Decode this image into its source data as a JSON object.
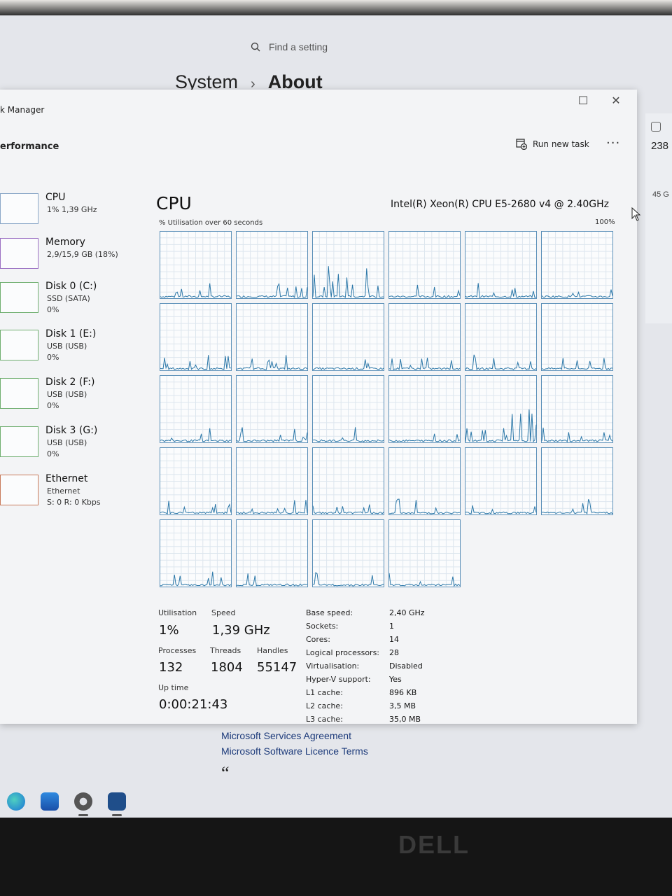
{
  "settings": {
    "search_placeholder": "Find a setting",
    "breadcrumb_parent": "System",
    "breadcrumb_separator": "›",
    "breadcrumb_current": "About",
    "right_value_1": "238",
    "right_value_2": "45 G",
    "links": [
      "Microsoft Services Agreement",
      "Microsoft Software Licence Terms"
    ],
    "quote_glyph": "“"
  },
  "task_manager": {
    "title": "k Manager",
    "section": "erformance",
    "run_new_task": "Run new task",
    "more": "···",
    "window_controls": {
      "maximize": "☐",
      "close": "✕"
    },
    "sidebar": [
      {
        "name": "CPU",
        "sub": [
          "1% 1,39 GHz"
        ],
        "kind": "cpu"
      },
      {
        "name": "Memory",
        "sub": [
          "2,9/15,9 GB (18%)"
        ],
        "kind": "mem"
      },
      {
        "name": "Disk 0 (C:)",
        "sub": [
          "SSD (SATA)",
          "0%"
        ],
        "kind": "disk"
      },
      {
        "name": "Disk 1 (E:)",
        "sub": [
          "USB (USB)",
          "0%"
        ],
        "kind": "disk"
      },
      {
        "name": "Disk 2 (F:)",
        "sub": [
          "USB (USB)",
          "0%"
        ],
        "kind": "disk"
      },
      {
        "name": "Disk 3 (G:)",
        "sub": [
          "USB (USB)",
          "0%"
        ],
        "kind": "disk"
      },
      {
        "name": "Ethernet",
        "sub": [
          "Ethernet",
          "S: 0 R: 0 Kbps"
        ],
        "kind": "eth"
      }
    ],
    "cpu": {
      "heading": "CPU",
      "model": "Intel(R) Xeon(R) CPU E5-2680 v4 @ 2.40GHz",
      "graph_caption": "% Utilisation over 60 seconds",
      "graph_max": "100%",
      "logical_processor_count": 28,
      "stats": {
        "utilisation_label": "Utilisation",
        "utilisation": "1%",
        "speed_label": "Speed",
        "speed": "1,39 GHz",
        "processes_label": "Processes",
        "processes": "132",
        "threads_label": "Threads",
        "threads": "1804",
        "handles_label": "Handles",
        "handles": "55147",
        "uptime_label": "Up time",
        "uptime": "0:00:21:43"
      },
      "specs": [
        {
          "label": "Base speed:",
          "value": "2,40 GHz"
        },
        {
          "label": "Sockets:",
          "value": "1"
        },
        {
          "label": "Cores:",
          "value": "14"
        },
        {
          "label": "Logical processors:",
          "value": "28"
        },
        {
          "label": "Virtualisation:",
          "value": "Disabled"
        },
        {
          "label": "Hyper-V support:",
          "value": "Yes"
        },
        {
          "label": "L1 cache:",
          "value": "896 KB"
        },
        {
          "label": "L2 cache:",
          "value": "3,5 MB"
        },
        {
          "label": "L3 cache:",
          "value": "35,0 MB"
        }
      ]
    }
  },
  "brand": "DELL"
}
